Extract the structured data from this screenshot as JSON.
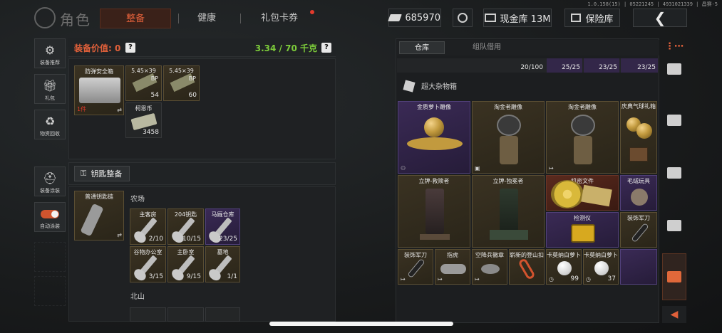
{
  "version": "1.0.158(15) | 05221245 | 4931021339 | 昌赛-5",
  "header": {
    "title": "角色",
    "tabs": [
      {
        "label": "整备",
        "active": true
      },
      {
        "label": "健康",
        "active": false
      },
      {
        "label": "礼包卡券",
        "active": false
      }
    ],
    "currency": "685970",
    "cash_store": "现金库 13M",
    "safe_box": "保险库"
  },
  "left_sidebar": {
    "items": [
      {
        "label": "装备推荐",
        "icon": "gun-icon"
      },
      {
        "label": "礼包",
        "icon": "gift-icon"
      },
      {
        "label": "物资回收",
        "icon": "recycle-icon"
      },
      {
        "label": "装备涂装",
        "icon": "helmet-icon"
      },
      {
        "label": "自动涂装",
        "icon": "toggle-icon",
        "toggle_on": true
      }
    ]
  },
  "equipment": {
    "value_label": "装备价值: 0",
    "weight": "3.34 / 70 千克",
    "safe_box": {
      "name": "防弹安全箱",
      "timer": "1件"
    },
    "safe_items": [
      {
        "name": "5.45×39",
        "sub": "BP",
        "count": "54"
      },
      {
        "name": "5.45×39",
        "sub": "BP",
        "count": "60"
      },
      {
        "name": "柯恩币",
        "count": "3458"
      }
    ],
    "keychain_label": "钥匙整备",
    "keychain_name": "普通钥匙链",
    "groups": [
      {
        "title": "农场",
        "keys": [
          {
            "name": "主客房",
            "count": "2/10",
            "rarity": "gold"
          },
          {
            "name": "204钥匙",
            "count": "10/15",
            "rarity": "gold"
          },
          {
            "name": "马厩仓库",
            "count": "23/25",
            "rarity": "purple"
          },
          {
            "name": "谷物办公室",
            "count": "3/15",
            "rarity": "gold"
          },
          {
            "name": "主卧室",
            "count": "9/15",
            "rarity": "gold"
          },
          {
            "name": "墓地",
            "count": "1/1",
            "rarity": "gold"
          }
        ]
      },
      {
        "title": "北山",
        "keys": []
      }
    ]
  },
  "warehouse": {
    "tabs": [
      {
        "label": "仓库",
        "active": true
      },
      {
        "label": "组队借用",
        "active": false
      }
    ],
    "strip": [
      "20/100",
      "25/25",
      "23/25",
      "23/25"
    ],
    "container_label": "超大杂物箱",
    "items": [
      {
        "name": "金质萝卜雕像",
        "rarity": "purple"
      },
      {
        "name": "淘金者雕像",
        "rarity": "gold"
      },
      {
        "name": "淘金者雕像",
        "rarity": "gold"
      },
      {
        "name": "庆典气球礼箱",
        "rarity": "gold"
      },
      {
        "name": "立牌-救赎者",
        "rarity": "gold"
      },
      {
        "name": "立牌-独冕者",
        "rarity": "gold"
      },
      {
        "name": "机密文件",
        "rarity": "red"
      },
      {
        "name": "毛绒玩具",
        "rarity": "purple"
      },
      {
        "name": "检测仪",
        "rarity": "purple"
      },
      {
        "name": "装饰军刀",
        "rarity": "gold"
      },
      {
        "name": "装饰军刀",
        "rarity": "gold"
      },
      {
        "name": "指虎",
        "rarity": "gold"
      },
      {
        "name": "空降兵徽章",
        "rarity": "gold"
      },
      {
        "name": "崭新的登山扣",
        "rarity": "gold"
      },
      {
        "name": "卡莫纳白萝卜",
        "count": "99",
        "rarity": "gold"
      },
      {
        "name": "卡莫纳白萝卜",
        "count": "37",
        "rarity": "gold"
      }
    ]
  },
  "colors": {
    "accent": "#e0603a",
    "weight_green": "#7ccb3a",
    "purple": "#3a2a55",
    "gold": "#3a3222"
  }
}
